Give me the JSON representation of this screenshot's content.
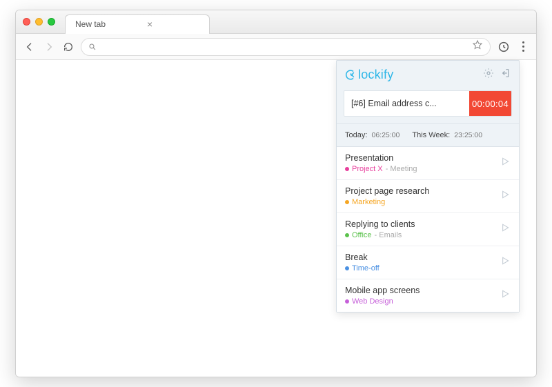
{
  "browser": {
    "tab_title": "New tab",
    "close_glyph": "×"
  },
  "popup": {
    "brand": "lockify",
    "timer": {
      "description": "[#6] Email address c...",
      "elapsed": "00:00:04"
    },
    "stats": {
      "today_label": "Today:",
      "today_value": "06:25:00",
      "week_label": "This Week:",
      "week_value": "23:25:00"
    },
    "entries": [
      {
        "title": "Presentation",
        "project": "Project X",
        "task": "Meeting",
        "color": "#e83e9c"
      },
      {
        "title": "Project page research",
        "project": "Marketing",
        "task": "",
        "color": "#f5a623"
      },
      {
        "title": "Replying to clients",
        "project": "Office",
        "task": "Emails",
        "color": "#5bc24c"
      },
      {
        "title": "Break",
        "project": "Time-off",
        "task": "",
        "color": "#4a90e2"
      },
      {
        "title": "Mobile app screens",
        "project": "Web Design",
        "task": "",
        "color": "#c65fd9"
      }
    ]
  }
}
